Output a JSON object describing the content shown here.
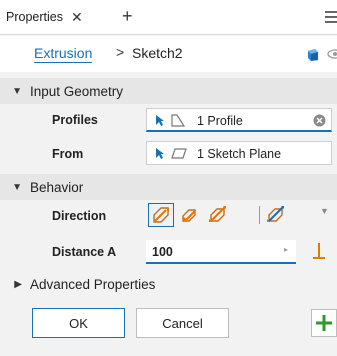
{
  "titlebar": {
    "tab_label": "Properties",
    "close_glyph": "✕",
    "add_glyph": "+"
  },
  "breadcrumb": {
    "feature": "Extrusion",
    "separator": ">",
    "current": "Sketch2"
  },
  "input_geometry": {
    "header": "Input Geometry",
    "profiles_label": "Profiles",
    "profiles_value": "1 Profile",
    "from_label": "From",
    "from_value": "1 Sketch Plane"
  },
  "behavior": {
    "header": "Behavior",
    "direction_label": "Direction",
    "distance_label": "Distance A",
    "distance_value": "100"
  },
  "advanced": {
    "header": "Advanced Properties"
  },
  "buttons": {
    "ok": "OK",
    "cancel": "Cancel"
  },
  "icons": {
    "expanded": "▼",
    "collapsed": "▶",
    "spinner": "▸",
    "dropdown": "▼"
  },
  "colors": {
    "accent": "#1a6fb5",
    "plus_green": "#2e9a2e",
    "measure_orange": "#e07a00"
  }
}
